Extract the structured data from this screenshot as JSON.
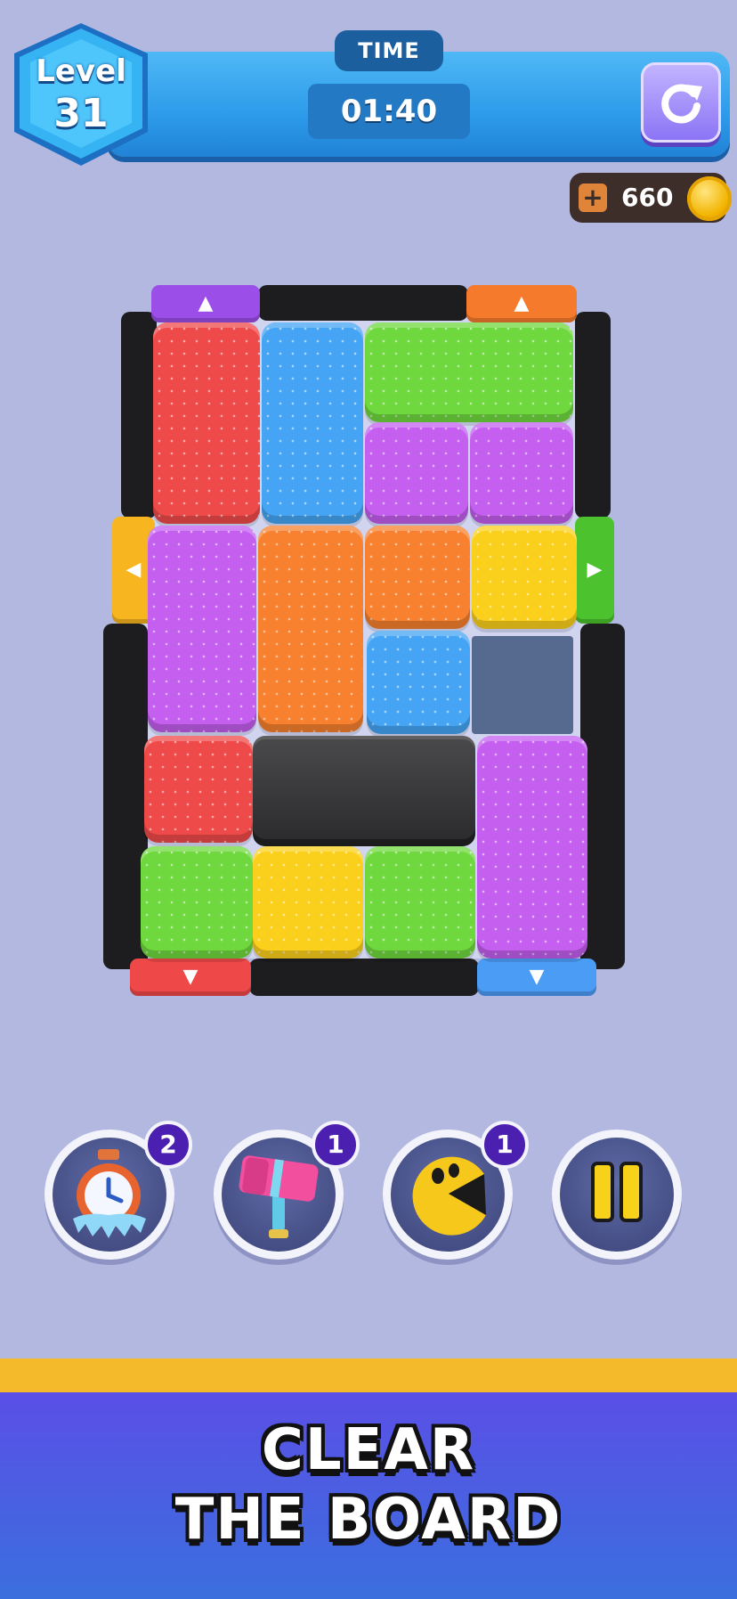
{
  "hud": {
    "level_label": "Level",
    "level_number": "31",
    "time_label": "TIME",
    "time_value": "01:40",
    "restart_icon": "restart-icon",
    "coins": "660",
    "coin_add_symbol": "+"
  },
  "board": {
    "gates": [
      {
        "color": "#9b4ee8",
        "direction": "up",
        "arrow": "▲"
      },
      {
        "color": "#f57a2c",
        "direction": "up",
        "arrow": "▲"
      },
      {
        "color": "#f7b51f",
        "direction": "left",
        "arrow": "◀"
      },
      {
        "color": "#4cc22e",
        "direction": "right",
        "arrow": "▶"
      },
      {
        "color": "#ef4848",
        "direction": "down",
        "arrow": "▼"
      },
      {
        "color": "#4b9cf5",
        "direction": "down",
        "arrow": "▼"
      }
    ],
    "tiles": [
      {
        "color": "red",
        "hex": "#ef4a4a"
      },
      {
        "color": "blue",
        "hex": "#45a5f4"
      },
      {
        "color": "green",
        "hex": "#6fd83e"
      },
      {
        "color": "purple",
        "hex": "#c45ff0"
      },
      {
        "color": "purple",
        "hex": "#c45ff0"
      },
      {
        "color": "purple",
        "hex": "#c45ff0"
      },
      {
        "color": "orange",
        "hex": "#f7812f"
      },
      {
        "color": "orange",
        "hex": "#f7812f"
      },
      {
        "color": "yellow",
        "hex": "#fbd01c"
      },
      {
        "color": "blue",
        "hex": "#45a5f4"
      },
      {
        "color": "red",
        "hex": "#ef4a4a"
      },
      {
        "color": "purple",
        "hex": "#c45ff0"
      },
      {
        "color": "green",
        "hex": "#6fd83e"
      },
      {
        "color": "yellow",
        "hex": "#fbd01c"
      },
      {
        "color": "green",
        "hex": "#6fd83e"
      }
    ],
    "obstacle": "stone-block"
  },
  "powerups": [
    {
      "name": "freeze-timer",
      "icon": "frozen-stopwatch-icon",
      "count": "2"
    },
    {
      "name": "hammer",
      "icon": "hammer-icon",
      "count": "1"
    },
    {
      "name": "pacman",
      "icon": "pacman-icon",
      "count": "1"
    },
    {
      "name": "pause",
      "icon": "pause-icon"
    }
  ],
  "banner": {
    "line1": "CLEAR",
    "line2": "THE BOARD"
  },
  "colors": {
    "background": "#b3b8e0",
    "hud_blue": "#2d9bea",
    "banner_stripe": "#f5b92c",
    "banner_blue": "#4a5fe2"
  }
}
